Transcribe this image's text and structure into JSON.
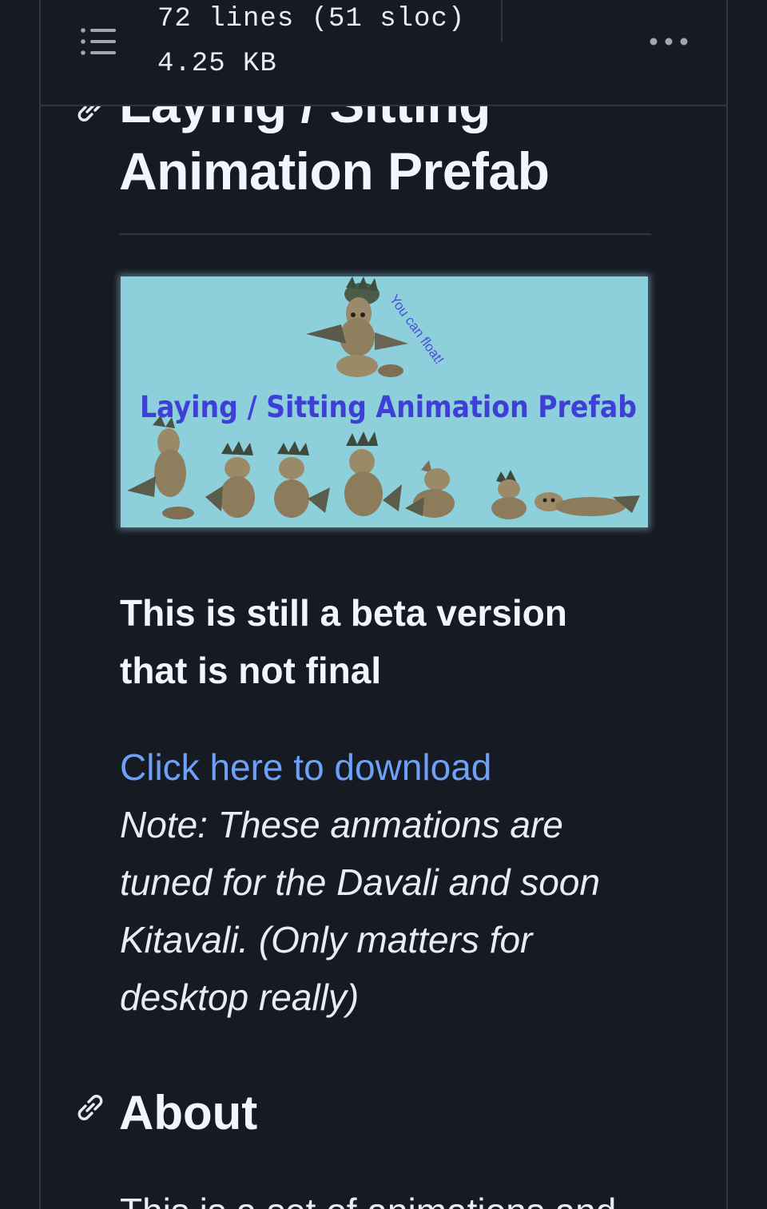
{
  "header": {
    "lines": "72 lines (51 sloc)",
    "size": "4.25 KB",
    "toc_icon": "list-icon",
    "more_icon": "kebab-horizontal-icon"
  },
  "readme": {
    "title": "Laying / Sitting Animation Prefab",
    "anchor_icon": "link-icon",
    "banner": {
      "title": "Laying / Sitting Animation Prefab",
      "caption": "You can float!",
      "background": "#8ecfdc",
      "title_color": "#3e3fd6"
    },
    "beta_notice": "This is still a beta version that is not final",
    "download_link": "Click here to download",
    "note": "Note: These anmations are tuned for the Davali and soon Kitavali. (Only matters for desktop really)",
    "about_heading": "About",
    "about_text": "This is a set of animations and"
  },
  "colors": {
    "background": "#161a23",
    "border": "#30363d",
    "text": "#e6edf3",
    "link": "#6ea0f8"
  }
}
